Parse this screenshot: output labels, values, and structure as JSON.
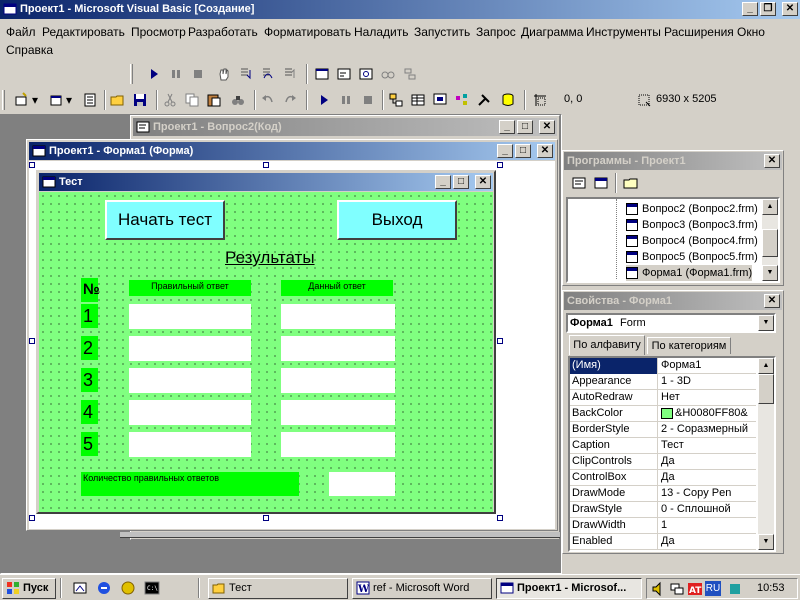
{
  "window": {
    "title": "Проект1 - Microsoft Visual Basic [Создание]"
  },
  "menu": [
    "Файл",
    "Редактировать",
    "Просмотр",
    "Разработать",
    "Форматировать",
    "Наладить",
    "Запустить",
    "Запрос",
    "Диаграмма",
    "Инструменты",
    "Расширения",
    "Окно",
    "Справка"
  ],
  "toolbar": {
    "coords": "0, 0",
    "size": "6930 x 5205"
  },
  "code_window": {
    "title": "Проект1 - Вопрос2(Код)"
  },
  "form_window": {
    "title": "Проект1 - Форма1 (Форма)"
  },
  "test_form": {
    "caption": "Тест",
    "start_button": "Начать тест",
    "exit_button": "Выход",
    "results_label": "Результаты",
    "number_header": "№",
    "correct_header": "Правильный ответ",
    "given_header": "Данный ответ",
    "row_numbers": [
      "1",
      "2",
      "3",
      "4",
      "5"
    ],
    "count_label": "Количество правильных ответов",
    "bg_color": "#80ff80",
    "label_color": "#00ff00",
    "button_color": "#80ffff"
  },
  "project_explorer": {
    "title": "Программы - Проект1",
    "items": [
      "Вопрос2 (Вопрос2.frm)",
      "Вопрос3 (Вопрос3.frm)",
      "Вопрос4 (Вопрос4.frm)",
      "Вопрос5 (Вопрос5.frm)",
      "Форма1 (Форма1.frm)"
    ]
  },
  "properties": {
    "title": "Свойства - Форма1",
    "object_name": "Форма1",
    "object_type": "Form",
    "tab_alpha": "По алфавиту",
    "tab_category": "По категориям",
    "rows": [
      {
        "name": "(Имя)",
        "value": "Форма1"
      },
      {
        "name": "Appearance",
        "value": "1 - 3D"
      },
      {
        "name": "AutoRedraw",
        "value": "Нет"
      },
      {
        "name": "BackColor",
        "value": "&H0080FF80&"
      },
      {
        "name": "BorderStyle",
        "value": "2 - Соразмерный"
      },
      {
        "name": "Caption",
        "value": "Тест"
      },
      {
        "name": "ClipControls",
        "value": "Да"
      },
      {
        "name": "ControlBox",
        "value": "Да"
      },
      {
        "name": "DrawMode",
        "value": "13 - Copy Pen"
      },
      {
        "name": "DrawStyle",
        "value": "0 - Сплошной"
      },
      {
        "name": "DrawWidth",
        "value": "1"
      },
      {
        "name": "Enabled",
        "value": "Да"
      }
    ],
    "backcolor_swatch": "#80ff80"
  },
  "taskbar": {
    "start": "Пуск",
    "tasks": [
      "Тест",
      "ref - Microsoft Word",
      "Проект1 - Microsof..."
    ],
    "lang": "RU",
    "clock": "10:53"
  }
}
